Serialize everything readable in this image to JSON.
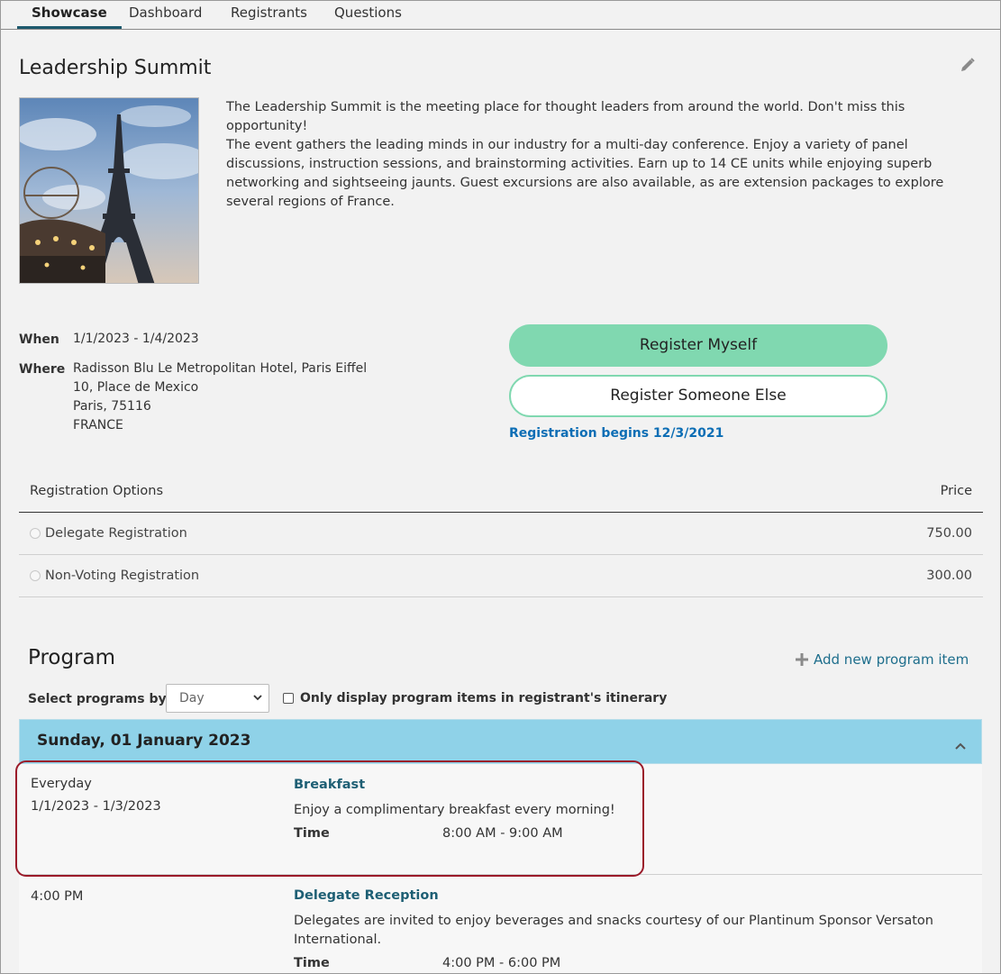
{
  "tabs": [
    {
      "label": "Showcase",
      "active": true
    },
    {
      "label": "Dashboard",
      "active": false
    },
    {
      "label": "Registrants",
      "active": false
    },
    {
      "label": "Questions",
      "active": false
    }
  ],
  "event": {
    "title": "Leadership Summit",
    "description": [
      "The Leadership Summit is the meeting place for thought leaders from around the world. Don't miss this opportunity!",
      "The event gathers the leading minds in our industry for a multi-day conference. Enjoy a variety of panel discussions, instruction sessions, and brainstorming activities. Earn up to 14 CE units while enjoying superb networking and sightseeing jaunts. Guest excursions are also available, as are extension packages to explore several regions of France."
    ],
    "when_label": "When",
    "when_value": "1/1/2023 - 1/4/2023",
    "where_label": "Where",
    "where_lines": [
      "Radisson Blu Le Metropolitan Hotel, Paris Eiffel",
      "10, Place de Mexico",
      "Paris, 75116",
      "FRANCE"
    ]
  },
  "actions": {
    "register_myself": "Register Myself",
    "register_someone_else": "Register Someone Else",
    "registration_begins": "Registration begins 12/3/2021"
  },
  "registration": {
    "header_option": "Registration Options",
    "header_price": "Price",
    "options": [
      {
        "label": "Delegate Registration",
        "price": "750.00"
      },
      {
        "label": "Non-Voting Registration",
        "price": "300.00"
      }
    ]
  },
  "program": {
    "title": "Program",
    "add_label": "Add new program item",
    "select_label": "Select programs by",
    "select_value": "Day",
    "checkbox_label": "Only display program items in registrant's itinerary",
    "day_title": "Sunday, 01 January 2023",
    "time_label": "Time",
    "items": [
      {
        "when_line1": "Everyday",
        "when_line2": "1/1/2023 - 1/3/2023",
        "title": "Breakfast",
        "description": "Enjoy a complimentary breakfast every morning!",
        "time": "8:00 AM - 9:00 AM"
      },
      {
        "when_line1": "4:00 PM",
        "when_line2": "",
        "title": "Delegate Reception",
        "description": "Delegates are invited to enjoy beverages and snacks courtesy of our Plantinum Sponsor Versaton International.",
        "time": "4:00 PM - 6:00 PM"
      }
    ]
  },
  "colors": {
    "primary_button": "#80d8b0",
    "link_blue": "#0d6eb5",
    "day_header": "#8fd2e8",
    "highlight": "#9b1b2a"
  },
  "icons": {
    "edit": "pencil-icon",
    "add": "plus-icon",
    "collapse": "chevron-up-icon",
    "select": "chevron-down-icon"
  }
}
